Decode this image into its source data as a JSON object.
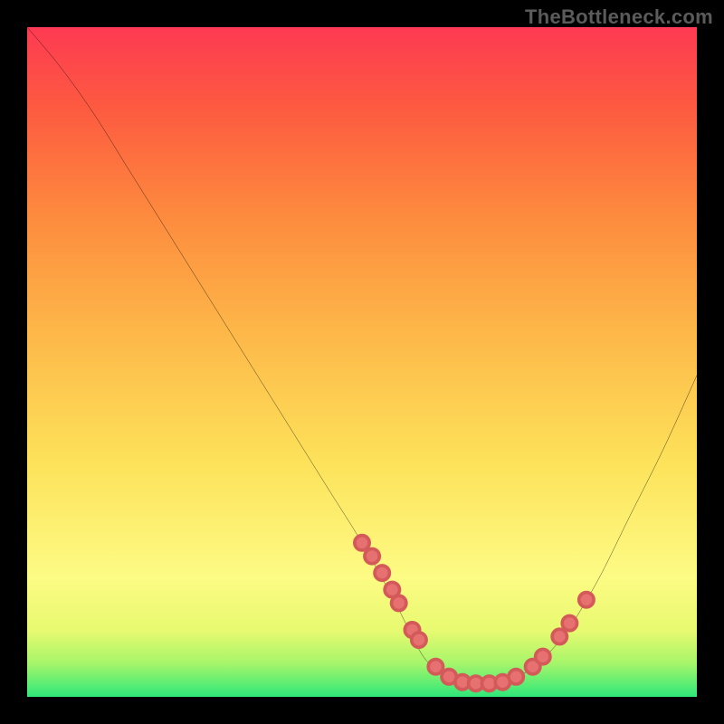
{
  "watermark": "TheBottleneck.com",
  "chart_data": {
    "type": "line",
    "title": "",
    "xlabel": "",
    "ylabel": "",
    "xlim": [
      0,
      100
    ],
    "ylim": [
      0,
      100
    ],
    "curve": {
      "name": "bottleneck-curve",
      "x": [
        0,
        5,
        10,
        15,
        20,
        25,
        30,
        35,
        40,
        45,
        50,
        55,
        58,
        60,
        63,
        66,
        70,
        75,
        80,
        85,
        90,
        95,
        100
      ],
      "y": [
        100,
        94,
        87,
        79,
        71,
        63,
        55,
        47,
        39,
        31,
        23,
        14,
        8,
        5,
        3,
        2,
        2,
        4,
        9,
        17,
        27,
        37,
        48
      ]
    },
    "highlight_points": {
      "name": "markers",
      "x": [
        50,
        51.5,
        53,
        54.5,
        55.5,
        57.5,
        58.5,
        61,
        63,
        65,
        67,
        69,
        71,
        73,
        75.5,
        77,
        79.5,
        81,
        83.5
      ],
      "y": [
        23,
        21,
        18.5,
        16,
        14,
        10,
        8.5,
        4.5,
        3,
        2.2,
        2,
        2,
        2.2,
        3,
        4.5,
        6,
        9,
        11,
        14.5
      ]
    },
    "background_gradient": {
      "stops": [
        {
          "pct": 0,
          "color": "#2ee87a"
        },
        {
          "pct": 5,
          "color": "#a6f56a"
        },
        {
          "pct": 10,
          "color": "#e8fa70"
        },
        {
          "pct": 18,
          "color": "#fdfb84"
        },
        {
          "pct": 35,
          "color": "#fde25a"
        },
        {
          "pct": 55,
          "color": "#fdb648"
        },
        {
          "pct": 72,
          "color": "#fd8a3e"
        },
        {
          "pct": 88,
          "color": "#fd5a40"
        },
        {
          "pct": 100,
          "color": "#fd3a53"
        }
      ]
    }
  }
}
